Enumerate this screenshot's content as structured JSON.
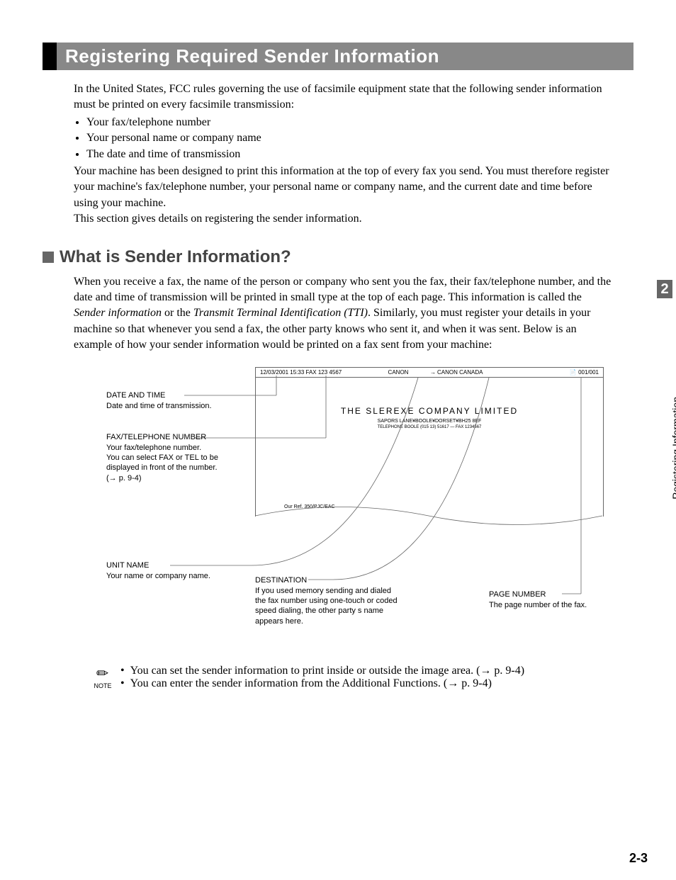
{
  "chapter": {
    "number": "2",
    "side_label": "Registering Information"
  },
  "heading": "Registering Required Sender Information",
  "intro": {
    "p1": "In the United States, FCC rules governing the use of facsimile equipment state that the following sender information must be printed on every facsimile transmission:",
    "bullets": [
      "Your fax/telephone number",
      "Your personal name or company name",
      "The date and time of transmission"
    ],
    "p2": "Your machine has been designed to print this information at the top of every fax you send. You must therefore register your machine's fax/telephone number, your personal name or company name, and the current date and time before using your machine.",
    "p3": "This section gives details on registering the sender information."
  },
  "subheading": "What is Sender Information?",
  "sub_intro": {
    "p1_pre": "When you receive a fax, the name of the person or company who sent you the fax, their fax/telephone number, and the date and time of transmission will be printed in small type at the top of each page. This information is called the ",
    "p1_em1": "Sender information",
    "p1_mid": " or the ",
    "p1_em2": "Transmit Terminal Identification (TTI)",
    "p1_post": ". Similarly, you must register your details in your machine so that whenever you send a fax, the other party knows who sent it, and when it was sent. Below is an example of how your sender information would be printed on a fax sent from your machine:"
  },
  "fax_sample": {
    "header_datetime": "12/03/2001  15:33  FAX 123 4567",
    "header_unit": "CANON",
    "header_dest_arrow": "→",
    "header_dest": "CANON CANADA",
    "header_page_icon": "📄",
    "header_page": "001/001",
    "body_company": "THE SLEREXE COMPANY LIMITED",
    "body_addr": "SAPORS LANE¥BOOLE¥DORSET¥BH25 8EF",
    "body_tel": "TELEPHONE BOOLE (015 13) 51617 — FAX 1234567",
    "body_ref": "Our Ref. 350/PJC/EAC"
  },
  "callouts": {
    "date_time": {
      "label": "DATE AND TIME",
      "desc": "Date and time of transmission."
    },
    "fax_tel": {
      "label": "FAX/TELEPHONE NUMBER",
      "desc": "Your fax/telephone number.\nYou can select FAX or TEL to be displayed in front of the number.\n(→ p. 9-4)"
    },
    "unit_name": {
      "label": "UNIT NAME",
      "desc": "Your name or company name."
    },
    "destination": {
      "label": "DESTINATION",
      "desc": "If you used memory sending and dialed the fax number using one-touch or coded speed dialing, the other party s name appears here."
    },
    "page_number": {
      "label": "PAGE NUMBER",
      "desc": "The page number of the fax."
    }
  },
  "notes": {
    "label": "NOTE",
    "items": [
      "You can set the sender information to print inside or outside the image area. (→ p. 9-4)",
      "You can enter the sender information from the Additional Functions. (→ p. 9-4)"
    ]
  },
  "page_number": "2-3"
}
